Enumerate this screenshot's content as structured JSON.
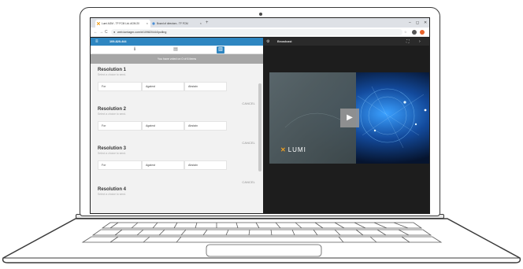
{
  "browser": {
    "tabs": [
      {
        "label": "Lumi AGM - TF FCM Ltd. AGM 20"
      },
      {
        "label": "Board of directors - TF FCM"
      }
    ],
    "new_tab": "+",
    "url": "web.lumiagm.com/#/109820444/polling",
    "window_controls": {
      "minimize": "–",
      "maximize": "◻",
      "close": "✕"
    },
    "nav": {
      "back": "←",
      "forward": "→",
      "reload": "C"
    }
  },
  "voting_panel": {
    "meeting_id": "109-820-444",
    "status_banner": "You have voted on 0 of 6 items",
    "resolutions": [
      {
        "title": "Resolution 1",
        "subtitle": "Select a choice to send.",
        "choices": [
          "For",
          "Against",
          "Abstain"
        ],
        "cancel": "CANCEL"
      },
      {
        "title": "Resolution 2",
        "subtitle": "Select a choice to send.",
        "choices": [
          "For",
          "Against",
          "Abstain"
        ],
        "cancel": "CANCEL"
      },
      {
        "title": "Resolution 3",
        "subtitle": "Select a choice to send.",
        "choices": [
          "For",
          "Against",
          "Abstain"
        ],
        "cancel": "CANCEL"
      },
      {
        "title": "Resolution 4",
        "subtitle": "Select a choice to send.",
        "choices": [],
        "cancel": ""
      }
    ]
  },
  "broadcast": {
    "title": "Broadcast",
    "logo_text": "LUMI",
    "play_label": "▶"
  }
}
